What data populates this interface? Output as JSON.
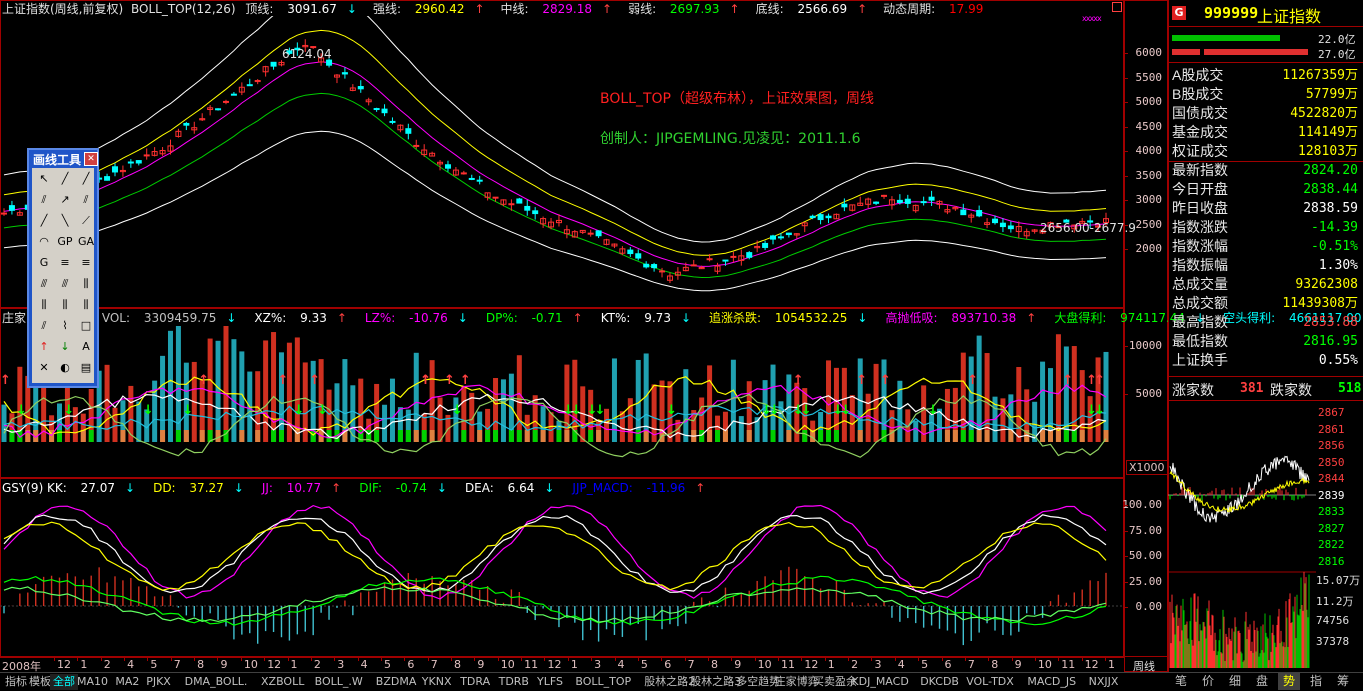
{
  "window": {
    "title_prefix": "上证指数(周线,前复权)",
    "indicator_name": "BOLL_TOP(12,26)"
  },
  "main_header": [
    {
      "label": "顶线:",
      "value": "3091.67",
      "color": "#ffffff",
      "arrow": "↓",
      "arrow_color": "#00ffff"
    },
    {
      "label": "强线:",
      "value": "2960.42",
      "color": "#ffff00",
      "arrow": "↑",
      "arrow_color": "#ff4040"
    },
    {
      "label": "中线:",
      "value": "2829.18",
      "color": "#ff00ff",
      "arrow": "↑",
      "arrow_color": "#ff4040"
    },
    {
      "label": "弱线:",
      "value": "2697.93",
      "color": "#00ff00",
      "arrow": "↑",
      "arrow_color": "#ff4040"
    },
    {
      "label": "底线:",
      "value": "2566.69",
      "color": "#ffffff",
      "arrow": "↑",
      "arrow_color": "#ff4040"
    },
    {
      "label": "动态周期:",
      "value": "17.99",
      "color": "#ff0000",
      "arrow": "",
      "arrow_color": "#ff4040"
    }
  ],
  "annotations": {
    "title_text": "BOLL_TOP（超级布林），上证效果图，周线",
    "author_text": "创制人：JIPGEMLING.见凌见：2011.1.6",
    "peak_label": "6124.04",
    "low_label": "2656.00-2677.9"
  },
  "main_axis": [
    "6000",
    "5500",
    "5000",
    "4500",
    "4000",
    "3500",
    "3000",
    "2500",
    "2000"
  ],
  "vol_header": {
    "prefix": "庄家",
    "items": [
      {
        "label": "VOL:",
        "value": "3309459.75",
        "color": "#c0c0c0",
        "arrow": "↓"
      },
      {
        "label": "XZ%:",
        "value": "9.33",
        "color": "#ffffff",
        "arrow": "↑"
      },
      {
        "label": "LZ%:",
        "value": "-10.76",
        "color": "#ff00ff",
        "arrow": "↓"
      },
      {
        "label": "DP%:",
        "value": "-0.71",
        "color": "#00ff00",
        "arrow": "↑"
      },
      {
        "label": "KT%:",
        "value": "9.73",
        "color": "#ffffff",
        "arrow": "↓"
      },
      {
        "label": "追涨杀跌:",
        "value": "1054532.25",
        "color": "#ffff00",
        "arrow": "↓"
      },
      {
        "label": "高抛低吸:",
        "value": "893710.38",
        "color": "#ff00ff",
        "arrow": "↑"
      },
      {
        "label": "大盘得利:",
        "value": "974117.44",
        "color": "#00ff00",
        "arrow": "↓"
      },
      {
        "label": "空头得利:",
        "value": "4661117.00",
        "color": "#00ffff",
        "arrow": "↓"
      }
    ]
  },
  "vol_axis": [
    "10000",
    "5000"
  ],
  "vol_unit": "X1000",
  "kd_header": [
    {
      "label": "GSY(9) KK:",
      "value": "27.07",
      "color": "#ffffff",
      "arrow": "↓"
    },
    {
      "label": "DD:",
      "value": "37.27",
      "color": "#ffff00",
      "arrow": "↓"
    },
    {
      "label": "JJ:",
      "value": "10.77",
      "color": "#ff00ff",
      "arrow": "↑"
    },
    {
      "label": "DIF:",
      "value": "-0.74",
      "color": "#00ff00",
      "arrow": "↓"
    },
    {
      "label": "DEA:",
      "value": "6.64",
      "color": "#ffffff",
      "arrow": "↓"
    },
    {
      "label": "JJP_MACD:",
      "value": "-11.96",
      "color": "#0000ff",
      "arrow": "↑"
    }
  ],
  "kd_axis": [
    "100.00",
    "75.00",
    "50.00",
    "25.00",
    "0.00"
  ],
  "date_axis": {
    "year": "2008年",
    "labels": [
      "12",
      "1",
      "2",
      "4",
      "5",
      "7",
      "8",
      "9",
      "10",
      "12",
      "1",
      "2",
      "3",
      "4",
      "5",
      "6",
      "7",
      "8",
      "9",
      "10",
      "11",
      "12",
      "1",
      "3",
      "4",
      "5",
      "6",
      "7",
      "8",
      "9",
      "10",
      "11",
      "12",
      "1",
      "2",
      "3",
      "4",
      "5",
      "6",
      "7",
      "8",
      "9",
      "10",
      "11",
      "12",
      "1"
    ],
    "period": "周线"
  },
  "toolbar_tabs": [
    "指标",
    "模板",
    "全部",
    "MA10",
    "MA2",
    "PJKX",
    "DMA_BOLL.",
    "XZBOLL",
    "BOLL_.W",
    "BZDMA",
    "YKNX",
    "TDRA",
    "TDRB",
    "YLFS",
    "BOLL_TOP",
    "股林之路2",
    "股林之路3",
    "多空趋势",
    "庄家博弈",
    "买卖盈余",
    "KDJ_MACD",
    "DKCDB",
    "VOL-TDX",
    "MACD_JS",
    "NXJJX"
  ],
  "active_tab": "全部",
  "draw_tool": {
    "title": "画线工具",
    "close": "✕",
    "buttons": [
      "↖",
      "╱",
      "╱",
      "⫽",
      "↗",
      "⫽",
      "╱",
      "╲",
      "⟋",
      "◠",
      "GP",
      "GA",
      "G",
      "≡",
      "≡",
      "⫻",
      "⫻",
      "⫼",
      "⫼",
      "⫼",
      "⫼",
      "⫽",
      "⌇",
      "□",
      "↑",
      "↓",
      "A",
      "✕",
      "◐",
      "▤"
    ]
  },
  "quote": {
    "badge": "G",
    "code": "999999",
    "name": "上证指数",
    "bar_top_value": "22.0亿",
    "bar_bottom_value": "27.0亿",
    "rows": [
      {
        "label": "A股成交",
        "value": "11267359万",
        "color": "#ffff00"
      },
      {
        "label": "B股成交",
        "value": "57799万",
        "color": "#ffff00"
      },
      {
        "label": "国债成交",
        "value": "4522820万",
        "color": "#ffff00"
      },
      {
        "label": "基金成交",
        "value": "114149万",
        "color": "#ffff00"
      },
      {
        "label": "权证成交",
        "value": "128103万",
        "color": "#ffff00"
      },
      {
        "label": "最新指数",
        "value": "2824.20",
        "color": "#00ff00"
      },
      {
        "label": "今日开盘",
        "value": "2838.44",
        "color": "#00ff00"
      },
      {
        "label": "昨日收盘",
        "value": "2838.59",
        "color": "#ffffff"
      },
      {
        "label": "指数涨跌",
        "value": "-14.39",
        "color": "#00ff00"
      },
      {
        "label": "指数涨幅",
        "value": "-0.51%",
        "color": "#00ff00"
      },
      {
        "label": "指数振幅",
        "value": "1.30%",
        "color": "#ffffff"
      },
      {
        "label": "总成交量",
        "value": "93262308",
        "color": "#ffff00"
      },
      {
        "label": "总成交额",
        "value": "11439308万",
        "color": "#ffff00"
      },
      {
        "label": "最高指数",
        "value": "2853.88",
        "color": "#ff4040"
      },
      {
        "label": "最低指数",
        "value": "2816.95",
        "color": "#00ff00"
      },
      {
        "label": "上证换手",
        "value": "0.55%",
        "color": "#ffffff"
      }
    ],
    "rise_label": "涨家数",
    "rise_value": "381",
    "fall_label": "跌家数",
    "fall_value": "518"
  },
  "mini_axis": [
    "2867",
    "2861",
    "2856",
    "2850",
    "2844",
    "2839",
    "2833",
    "2827",
    "2822",
    "2816"
  ],
  "mini_vol_axis": [
    "15.07万",
    "11.2万",
    "74756",
    "37378"
  ],
  "mini_tabs": [
    "笔",
    "价",
    "细",
    "盘",
    "势",
    "指",
    "筹"
  ],
  "mini_active_tab": "势"
}
